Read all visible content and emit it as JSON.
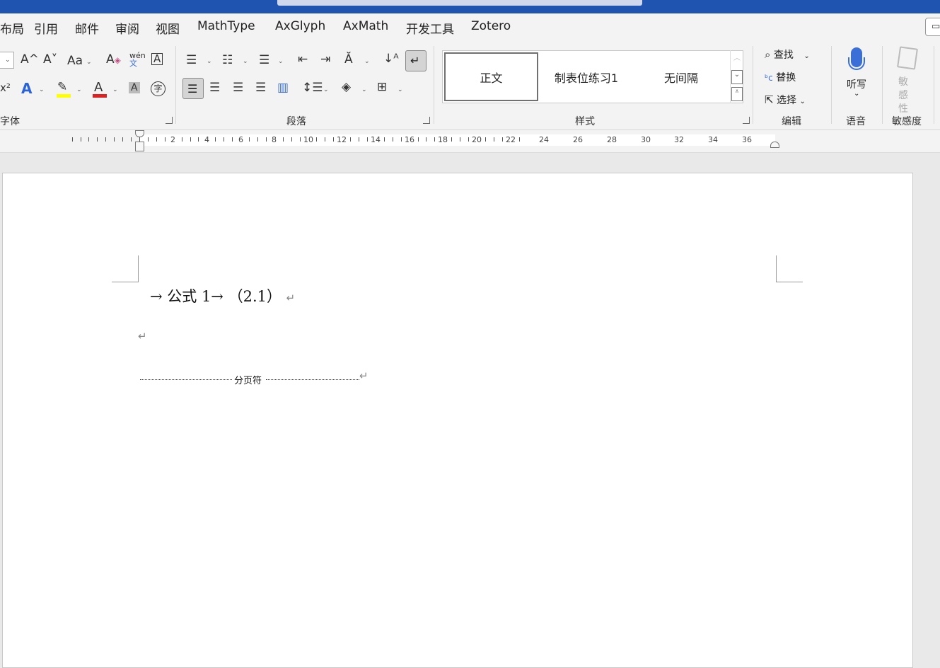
{
  "menu": {
    "tabs": [
      "布局",
      "引用",
      "邮件",
      "审阅",
      "视图",
      "MathType",
      "AxGlyph",
      "AxMath",
      "开发工具",
      "Zotero"
    ]
  },
  "ribbon": {
    "groups": {
      "font": "字体",
      "paragraph": "段落",
      "styles": "样式",
      "editing": "编辑",
      "voice": "语音",
      "sensitivity": "敏感度"
    },
    "font_icons": {
      "grow": "A^",
      "shrink": "A˅",
      "case": "Aa",
      "phonetic_top": "wén",
      "phonetic_bottom": "文",
      "superscript": "x²",
      "enclose": "字"
    },
    "styles": [
      "正文",
      "制表位练习1",
      "无间隔"
    ],
    "editing": {
      "find": "查找",
      "replace": "替换",
      "select": "选择"
    },
    "voice": {
      "dictate": "听写"
    },
    "sensitivity": {
      "label": "敏感性"
    }
  },
  "ruler": {
    "numbers": [
      "2",
      "4",
      "6",
      "8",
      "10",
      "12",
      "14",
      "16",
      "18",
      "20",
      "22",
      "24",
      "26",
      "28",
      "30",
      "32",
      "34",
      "36"
    ]
  },
  "document": {
    "line1": "→ 公式 1→ （2.1）",
    "return_mark": "↵",
    "page_break_label": "分页符"
  },
  "colors": {
    "title_bar": "#1f55b0",
    "highlight": "#ffff00",
    "font_color": "#e02020",
    "dictate": "#3a6fd8"
  }
}
